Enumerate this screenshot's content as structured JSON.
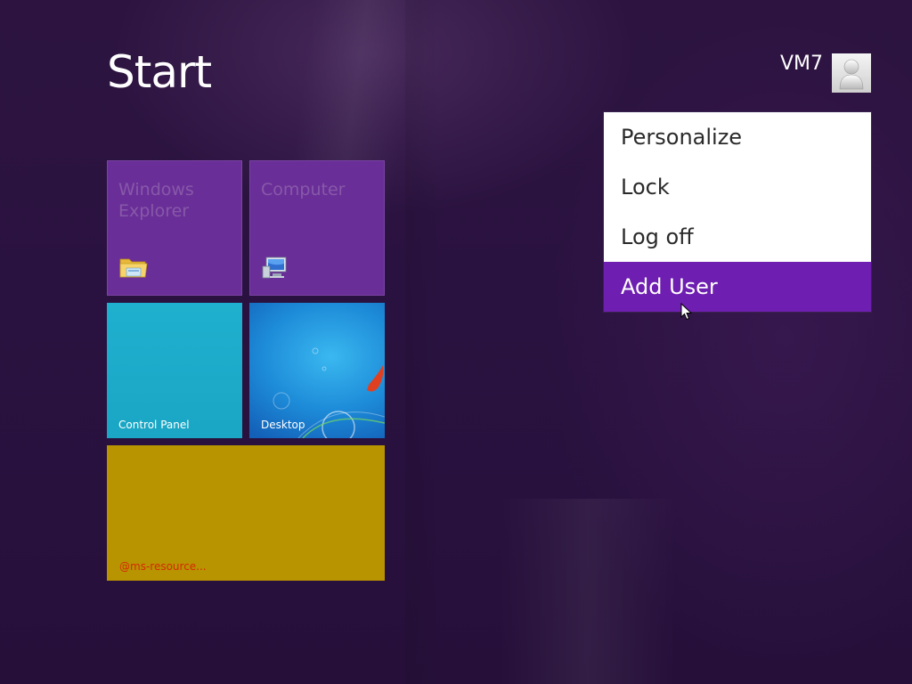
{
  "screen": {
    "title": "Start"
  },
  "user": {
    "name": "VM7",
    "avatar_icon": "user-silhouette-icon"
  },
  "account_menu": {
    "items": [
      {
        "label": "Personalize",
        "active": false
      },
      {
        "label": "Lock",
        "active": false
      },
      {
        "label": "Log off",
        "active": false
      },
      {
        "label": "Add User",
        "active": true
      }
    ],
    "active_color": "#6e1eb0"
  },
  "tiles": [
    {
      "id": "windows-explorer",
      "title": "Windows Explorer",
      "label": "",
      "color": "#6a2e98",
      "icon": "folder-icon"
    },
    {
      "id": "computer",
      "title": "Computer",
      "label": "",
      "color": "#6a2e98",
      "icon": "computer-icon"
    },
    {
      "id": "control-panel",
      "title": "",
      "label": "Control Panel",
      "color": "#1fb0cf",
      "icon": ""
    },
    {
      "id": "desktop",
      "title": "",
      "label": "Desktop",
      "color": "#1d8bd8",
      "icon": ""
    },
    {
      "id": "ms-resource",
      "title": "",
      "label": "@ms-resource...",
      "color": "#b89400",
      "icon": ""
    }
  ],
  "colors": {
    "background": "#2c123f",
    "accent": "#6e1eb0"
  }
}
